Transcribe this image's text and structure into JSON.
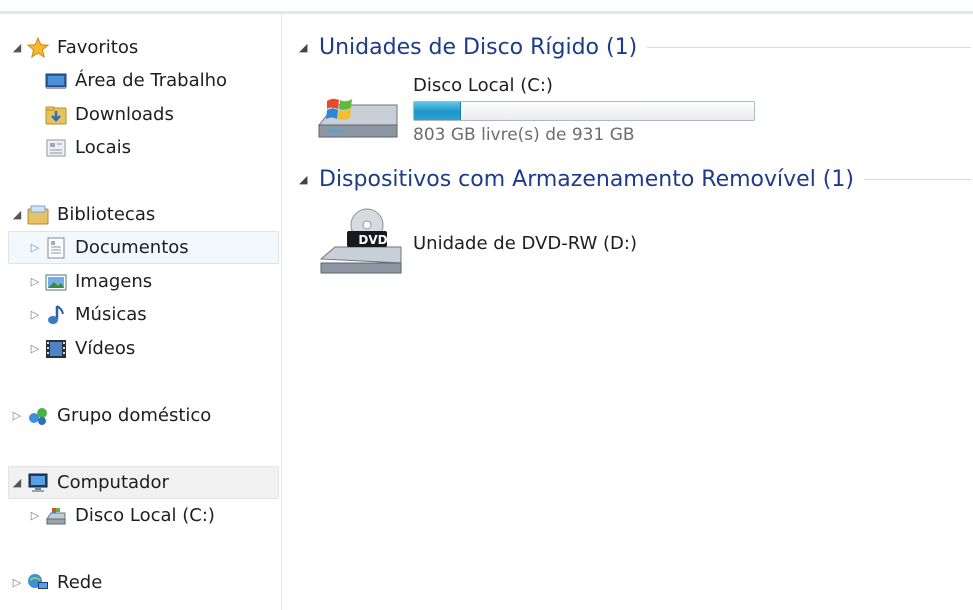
{
  "navigation": {
    "favorites": {
      "label": "Favoritos",
      "items": [
        {
          "label": "Área de Trabalho",
          "icon": "desktop-icon"
        },
        {
          "label": "Downloads",
          "icon": "downloads-folder-icon"
        },
        {
          "label": "Locais",
          "icon": "recent-places-icon"
        }
      ]
    },
    "libraries": {
      "label": "Bibliotecas",
      "items": [
        {
          "label": "Documentos",
          "icon": "documents-icon"
        },
        {
          "label": "Imagens",
          "icon": "pictures-icon"
        },
        {
          "label": "Músicas",
          "icon": "music-icon"
        },
        {
          "label": "Vídeos",
          "icon": "videos-icon"
        }
      ]
    },
    "homegroup": {
      "label": "Grupo doméstico",
      "icon": "homegroup-icon"
    },
    "computer": {
      "label": "Computador",
      "items": [
        {
          "label": "Disco Local (C:)",
          "icon": "local-disk-icon"
        }
      ]
    },
    "network": {
      "label": "Rede",
      "icon": "network-icon"
    }
  },
  "content": {
    "hard_drives": {
      "title": "Unidades de Disco Rígido (1)",
      "drives": [
        {
          "name": "Disco Local (C:)",
          "free_text": "803 GB livre(s) de 931 GB",
          "used_fraction": 0.1375
        }
      ]
    },
    "removable": {
      "title": "Dispositivos com Armazenamento Removível (1)",
      "devices": [
        {
          "name": "Unidade de DVD-RW (D:)",
          "icon_text": "DVD"
        }
      ]
    }
  },
  "colors": {
    "group_title": "#1e3b8a",
    "selection_bg": "#f3f8fd",
    "bar_fill": "#26a0d6"
  }
}
